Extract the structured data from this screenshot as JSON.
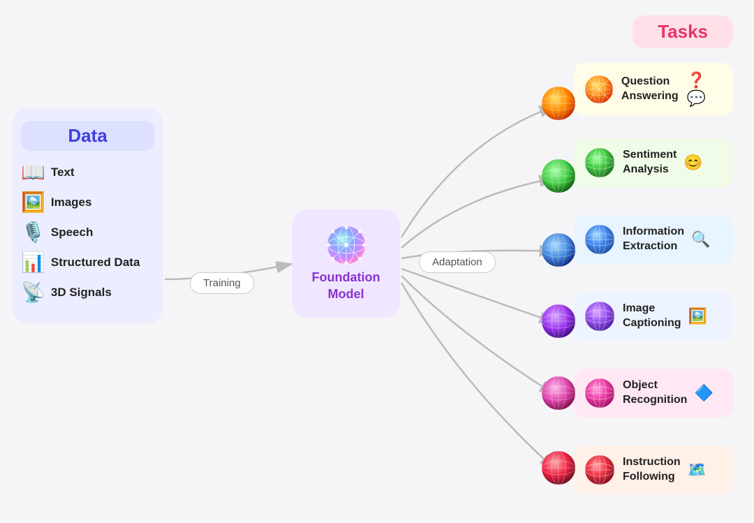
{
  "data_panel": {
    "title": "Data",
    "items": [
      {
        "label": "Text",
        "icon": "📖"
      },
      {
        "label": "Images",
        "icon": "🖼️"
      },
      {
        "label": "Speech",
        "icon": "🎙️"
      },
      {
        "label": "Structured Data",
        "icon": "📊"
      },
      {
        "label": "3D Signals",
        "icon": "📡"
      }
    ]
  },
  "training_label": "Training",
  "foundation_model_label": "Foundation\nModel",
  "adaptation_label": "Adaptation",
  "tasks_title": "Tasks",
  "tasks": [
    {
      "label": "Question\nAnswering",
      "bg": "#fffde7",
      "icon": "❓",
      "orb_color": "#e8a020"
    },
    {
      "label": "Sentiment\nAnalysis",
      "bg": "#f0fce8",
      "icon": "😊",
      "orb_color": "#66cc44"
    },
    {
      "label": "Information\nExtraction",
      "bg": "#e8f4ff",
      "icon": "🔍",
      "orb_color": "#5599dd"
    },
    {
      "label": "Image\nCaptioning",
      "bg": "#e8f8ff",
      "icon": "🖼️",
      "orb_color": "#8855cc"
    },
    {
      "label": "Object\nRecognition",
      "bg": "#ffe8f4",
      "icon": "🔷",
      "orb_color": "#dd44aa"
    },
    {
      "label": "Instruction\nFollowing",
      "bg": "#fff0e8",
      "icon": "🗺️",
      "orb_color": "#dd3344"
    }
  ]
}
